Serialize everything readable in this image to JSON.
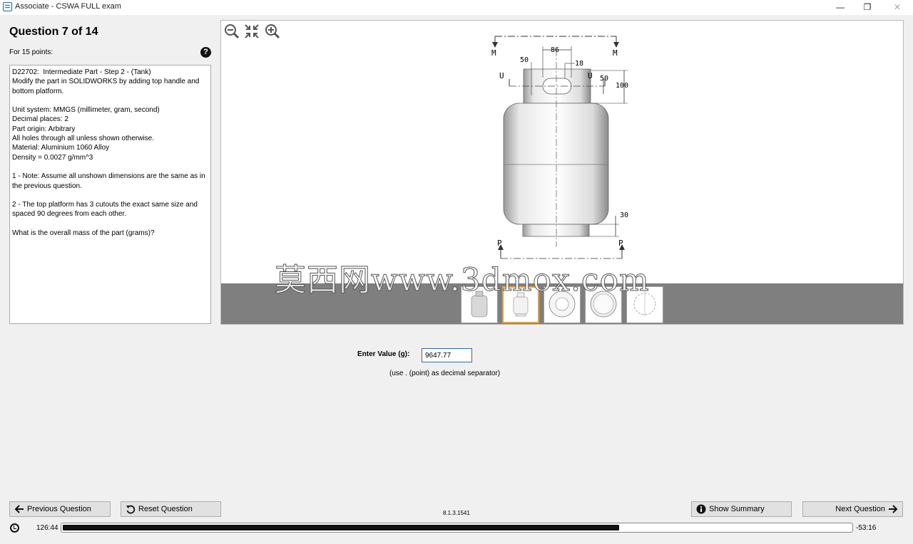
{
  "window": {
    "title": "Associate - CSWA FULL exam",
    "minimize_glyph": "—",
    "maximize_glyph": "❐",
    "close_glyph": "✕"
  },
  "question": {
    "title": "Question 7 of 14",
    "points": "For 15 points:",
    "help_glyph": "?",
    "lines": [
      "D22702:  Intermediate Part - Step 2 - (Tank)",
      "Modify the part in SOLIDWORKS by adding top handle and bottom platform.",
      "",
      "Unit system: MMGS (millimeter, gram, second)",
      "Decimal places: 2",
      "Part origin: Arbitrary",
      "All holes through all unless shown otherwise.",
      "Material: Aluminium 1060 Alloy",
      "Density = 0.0027 g/mm^3",
      "",
      "1 - Note: Assume all unshown dimensions are the same as in the previous question.",
      "",
      "2 - The top platform has 3 cutouts the exact same size and spaced 90 degrees from each other.",
      "",
      "What is the overall mass of the part (grams)?"
    ]
  },
  "viewer": {
    "tools": [
      "zoom-out-icon",
      "fit-icon",
      "zoom-in-icon"
    ],
    "drawing": {
      "dims": [
        "86",
        "50",
        "18",
        "50",
        "100",
        "30"
      ],
      "section_labels": [
        "M",
        "M",
        "U",
        "U",
        "P",
        "P"
      ]
    },
    "watermark": "莫西网www.3dmox.com",
    "thumbnails": 5,
    "selected_thumbnail": 2
  },
  "answer": {
    "label": "Enter Value (g):",
    "value": "9647.77",
    "hint": "(use . (point) as decimal separator)"
  },
  "nav": {
    "previous": "Previous Question",
    "reset": "Reset Question",
    "summary": "Show Summary",
    "next": "Next Question",
    "version": "8.1.3.1541"
  },
  "timer": {
    "elapsed": "126:44",
    "remaining": "-53:16",
    "progress_fraction": 0.705
  }
}
